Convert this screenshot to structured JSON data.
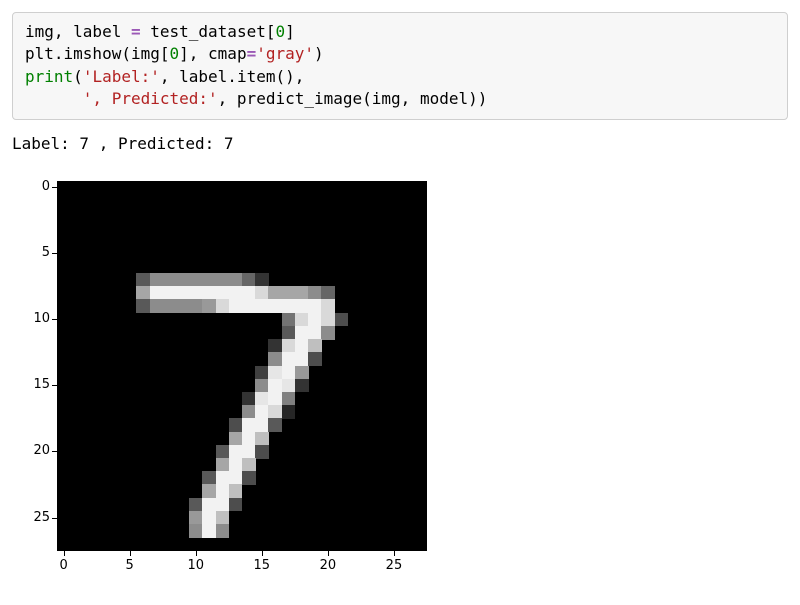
{
  "code": {
    "line1": {
      "t1": "img, label ",
      "op1": "=",
      "t2": " test_dataset[",
      "num1": "0",
      "t3": "]"
    },
    "line2": {
      "t1": "plt.imshow(img[",
      "num1": "0",
      "t2": "], cmap",
      "op1": "=",
      "str1": "'gray'",
      "t3": ")"
    },
    "line3": {
      "call1": "print",
      "t1": "(",
      "str1": "'Label:'",
      "t2": ", label.item(),"
    },
    "line4": {
      "t1": "      ",
      "str1": "', Predicted:'",
      "t2": ", predict_image(img, model))"
    }
  },
  "output": "Label: 7 , Predicted: 7",
  "chart_data": {
    "type": "heatmap",
    "title": "",
    "xlabel": "",
    "ylabel": "",
    "xlim": [
      -0.5,
      27.5
    ],
    "ylim": [
      27.5,
      -0.5
    ],
    "x_ticks": [
      0,
      5,
      10,
      15,
      20,
      25
    ],
    "y_ticks": [
      0,
      5,
      10,
      15,
      20,
      25
    ],
    "cmap": "gray",
    "description": "28x28 MNIST grayscale image depicting the handwritten digit 7",
    "pixels_nonzero": [
      {
        "r": 7,
        "c": 6,
        "v": 0.35
      },
      {
        "r": 7,
        "c": 7,
        "v": 0.55
      },
      {
        "r": 7,
        "c": 8,
        "v": 0.55
      },
      {
        "r": 7,
        "c": 9,
        "v": 0.55
      },
      {
        "r": 7,
        "c": 10,
        "v": 0.55
      },
      {
        "r": 7,
        "c": 11,
        "v": 0.55
      },
      {
        "r": 7,
        "c": 12,
        "v": 0.55
      },
      {
        "r": 7,
        "c": 13,
        "v": 0.55
      },
      {
        "r": 7,
        "c": 14,
        "v": 0.4
      },
      {
        "r": 7,
        "c": 15,
        "v": 0.2
      },
      {
        "r": 8,
        "c": 6,
        "v": 0.65
      },
      {
        "r": 8,
        "c": 7,
        "v": 0.95
      },
      {
        "r": 8,
        "c": 8,
        "v": 0.95
      },
      {
        "r": 8,
        "c": 9,
        "v": 0.95
      },
      {
        "r": 8,
        "c": 10,
        "v": 0.95
      },
      {
        "r": 8,
        "c": 11,
        "v": 0.95
      },
      {
        "r": 8,
        "c": 12,
        "v": 0.95
      },
      {
        "r": 8,
        "c": 13,
        "v": 0.95
      },
      {
        "r": 8,
        "c": 14,
        "v": 0.95
      },
      {
        "r": 8,
        "c": 15,
        "v": 0.85
      },
      {
        "r": 8,
        "c": 16,
        "v": 0.65
      },
      {
        "r": 8,
        "c": 17,
        "v": 0.65
      },
      {
        "r": 8,
        "c": 18,
        "v": 0.65
      },
      {
        "r": 8,
        "c": 19,
        "v": 0.55
      },
      {
        "r": 8,
        "c": 20,
        "v": 0.4
      },
      {
        "r": 9,
        "c": 6,
        "v": 0.35
      },
      {
        "r": 9,
        "c": 7,
        "v": 0.55
      },
      {
        "r": 9,
        "c": 8,
        "v": 0.55
      },
      {
        "r": 9,
        "c": 9,
        "v": 0.55
      },
      {
        "r": 9,
        "c": 10,
        "v": 0.55
      },
      {
        "r": 9,
        "c": 11,
        "v": 0.6
      },
      {
        "r": 9,
        "c": 12,
        "v": 0.85
      },
      {
        "r": 9,
        "c": 13,
        "v": 0.95
      },
      {
        "r": 9,
        "c": 14,
        "v": 0.95
      },
      {
        "r": 9,
        "c": 15,
        "v": 0.95
      },
      {
        "r": 9,
        "c": 16,
        "v": 0.95
      },
      {
        "r": 9,
        "c": 17,
        "v": 0.95
      },
      {
        "r": 9,
        "c": 18,
        "v": 0.95
      },
      {
        "r": 9,
        "c": 19,
        "v": 0.95
      },
      {
        "r": 9,
        "c": 20,
        "v": 0.85
      },
      {
        "r": 10,
        "c": 17,
        "v": 0.45
      },
      {
        "r": 10,
        "c": 18,
        "v": 0.85
      },
      {
        "r": 10,
        "c": 19,
        "v": 0.95
      },
      {
        "r": 10,
        "c": 20,
        "v": 0.85
      },
      {
        "r": 10,
        "c": 21,
        "v": 0.3
      },
      {
        "r": 11,
        "c": 17,
        "v": 0.35
      },
      {
        "r": 11,
        "c": 18,
        "v": 0.95
      },
      {
        "r": 11,
        "c": 19,
        "v": 0.95
      },
      {
        "r": 11,
        "c": 20,
        "v": 0.55
      },
      {
        "r": 12,
        "c": 16,
        "v": 0.2
      },
      {
        "r": 12,
        "c": 17,
        "v": 0.85
      },
      {
        "r": 12,
        "c": 18,
        "v": 0.95
      },
      {
        "r": 12,
        "c": 19,
        "v": 0.75
      },
      {
        "r": 13,
        "c": 16,
        "v": 0.55
      },
      {
        "r": 13,
        "c": 17,
        "v": 0.95
      },
      {
        "r": 13,
        "c": 18,
        "v": 0.95
      },
      {
        "r": 13,
        "c": 19,
        "v": 0.3
      },
      {
        "r": 14,
        "c": 15,
        "v": 0.25
      },
      {
        "r": 14,
        "c": 16,
        "v": 0.9
      },
      {
        "r": 14,
        "c": 17,
        "v": 0.95
      },
      {
        "r": 14,
        "c": 18,
        "v": 0.6
      },
      {
        "r": 15,
        "c": 15,
        "v": 0.55
      },
      {
        "r": 15,
        "c": 16,
        "v": 0.95
      },
      {
        "r": 15,
        "c": 17,
        "v": 0.9
      },
      {
        "r": 15,
        "c": 18,
        "v": 0.2
      },
      {
        "r": 16,
        "c": 14,
        "v": 0.2
      },
      {
        "r": 16,
        "c": 15,
        "v": 0.9
      },
      {
        "r": 16,
        "c": 16,
        "v": 0.95
      },
      {
        "r": 16,
        "c": 17,
        "v": 0.5
      },
      {
        "r": 17,
        "c": 14,
        "v": 0.55
      },
      {
        "r": 17,
        "c": 15,
        "v": 0.95
      },
      {
        "r": 17,
        "c": 16,
        "v": 0.85
      },
      {
        "r": 17,
        "c": 17,
        "v": 0.15
      },
      {
        "r": 18,
        "c": 13,
        "v": 0.3
      },
      {
        "r": 18,
        "c": 14,
        "v": 0.95
      },
      {
        "r": 18,
        "c": 15,
        "v": 0.95
      },
      {
        "r": 18,
        "c": 16,
        "v": 0.35
      },
      {
        "r": 19,
        "c": 13,
        "v": 0.65
      },
      {
        "r": 19,
        "c": 14,
        "v": 0.95
      },
      {
        "r": 19,
        "c": 15,
        "v": 0.75
      },
      {
        "r": 20,
        "c": 12,
        "v": 0.35
      },
      {
        "r": 20,
        "c": 13,
        "v": 0.95
      },
      {
        "r": 20,
        "c": 14,
        "v": 0.95
      },
      {
        "r": 20,
        "c": 15,
        "v": 0.3
      },
      {
        "r": 21,
        "c": 12,
        "v": 0.65
      },
      {
        "r": 21,
        "c": 13,
        "v": 0.95
      },
      {
        "r": 21,
        "c": 14,
        "v": 0.75
      },
      {
        "r": 22,
        "c": 11,
        "v": 0.35
      },
      {
        "r": 22,
        "c": 12,
        "v": 0.95
      },
      {
        "r": 22,
        "c": 13,
        "v": 0.95
      },
      {
        "r": 22,
        "c": 14,
        "v": 0.3
      },
      {
        "r": 23,
        "c": 11,
        "v": 0.65
      },
      {
        "r": 23,
        "c": 12,
        "v": 0.95
      },
      {
        "r": 23,
        "c": 13,
        "v": 0.75
      },
      {
        "r": 24,
        "c": 10,
        "v": 0.35
      },
      {
        "r": 24,
        "c": 11,
        "v": 0.95
      },
      {
        "r": 24,
        "c": 12,
        "v": 0.95
      },
      {
        "r": 24,
        "c": 13,
        "v": 0.3
      },
      {
        "r": 25,
        "c": 10,
        "v": 0.6
      },
      {
        "r": 25,
        "c": 11,
        "v": 0.95
      },
      {
        "r": 25,
        "c": 12,
        "v": 0.75
      },
      {
        "r": 26,
        "c": 10,
        "v": 0.55
      },
      {
        "r": 26,
        "c": 11,
        "v": 0.95
      },
      {
        "r": 26,
        "c": 12,
        "v": 0.55
      }
    ]
  }
}
